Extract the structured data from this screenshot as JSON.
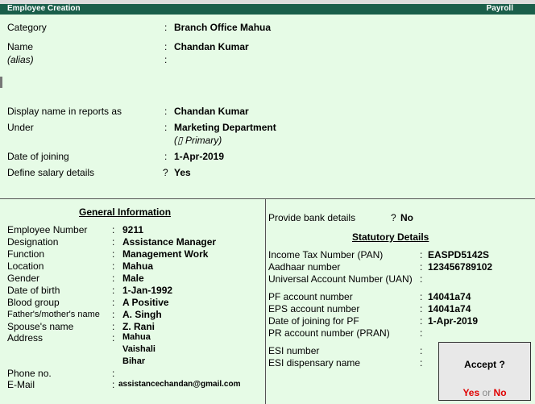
{
  "window": {
    "title": "Employee Creation",
    "company_label": "Payroll"
  },
  "top": {
    "category": {
      "label": "Category",
      "value": "Branch Office Mahua"
    },
    "name": {
      "label": "Name",
      "value": "Chandan Kumar"
    },
    "alias": {
      "label": "(alias)",
      "value": ""
    },
    "display_name": {
      "label": "Display name in reports as",
      "value": "Chandan Kumar"
    },
    "under": {
      "label": "Under",
      "value": "Marketing Department",
      "sub": "(⁠̸ Primary)"
    },
    "date_of_joining": {
      "label": "Date of joining",
      "value": "1-Apr-2019"
    },
    "define_salary": {
      "label": "Define salary details",
      "value": "Yes"
    }
  },
  "general": {
    "title": "General Information",
    "employee_number": {
      "label": "Employee Number",
      "value": "9211"
    },
    "designation": {
      "label": "Designation",
      "value": "Assistance Manager"
    },
    "function": {
      "label": "Function",
      "value": "Management Work"
    },
    "location": {
      "label": "Location",
      "value": "Mahua"
    },
    "gender": {
      "label": "Gender",
      "value": "Male"
    },
    "dob": {
      "label": "Date of birth",
      "value": "1-Jan-1992"
    },
    "blood_group": {
      "label": "Blood group",
      "value": "A Positive"
    },
    "parent": {
      "label": "Father's/mother's name",
      "value": "A. Singh"
    },
    "spouse": {
      "label": "Spouse's name",
      "value": "Z. Rani"
    },
    "address": {
      "label": "Address",
      "lines": [
        "Mahua",
        "Vaishali",
        "Bihar"
      ]
    },
    "phone": {
      "label": "Phone no.",
      "value": ""
    },
    "email": {
      "label": "E-Mail",
      "value": "assistancechandan@gmail.com"
    }
  },
  "right": {
    "bank": {
      "label": "Provide bank details",
      "value": "No"
    },
    "stat_title": "Statutory Details",
    "pan": {
      "label": "Income Tax Number (PAN)",
      "value": "EASPD5142S"
    },
    "aadhaar": {
      "label": "Aadhaar number",
      "value": "123456789102"
    },
    "uan": {
      "label": "Universal Account Number (UAN)",
      "value": ""
    },
    "pf": {
      "label": "PF account number",
      "value": "14041a74"
    },
    "eps": {
      "label": "EPS account number",
      "value": "14041a74"
    },
    "pf_join": {
      "label": "Date of joining for PF",
      "value": "1-Apr-2019"
    },
    "pran": {
      "label": "PR account number (PRAN)",
      "value": ""
    },
    "esi": {
      "label": "ESI number",
      "value": ""
    },
    "esi_disp": {
      "label": "ESI dispensary name",
      "value": ""
    }
  },
  "accept": {
    "question": "Accept ?",
    "yes": "Yes",
    "or": "or",
    "no": "No",
    "accent_color": "#e00000"
  }
}
